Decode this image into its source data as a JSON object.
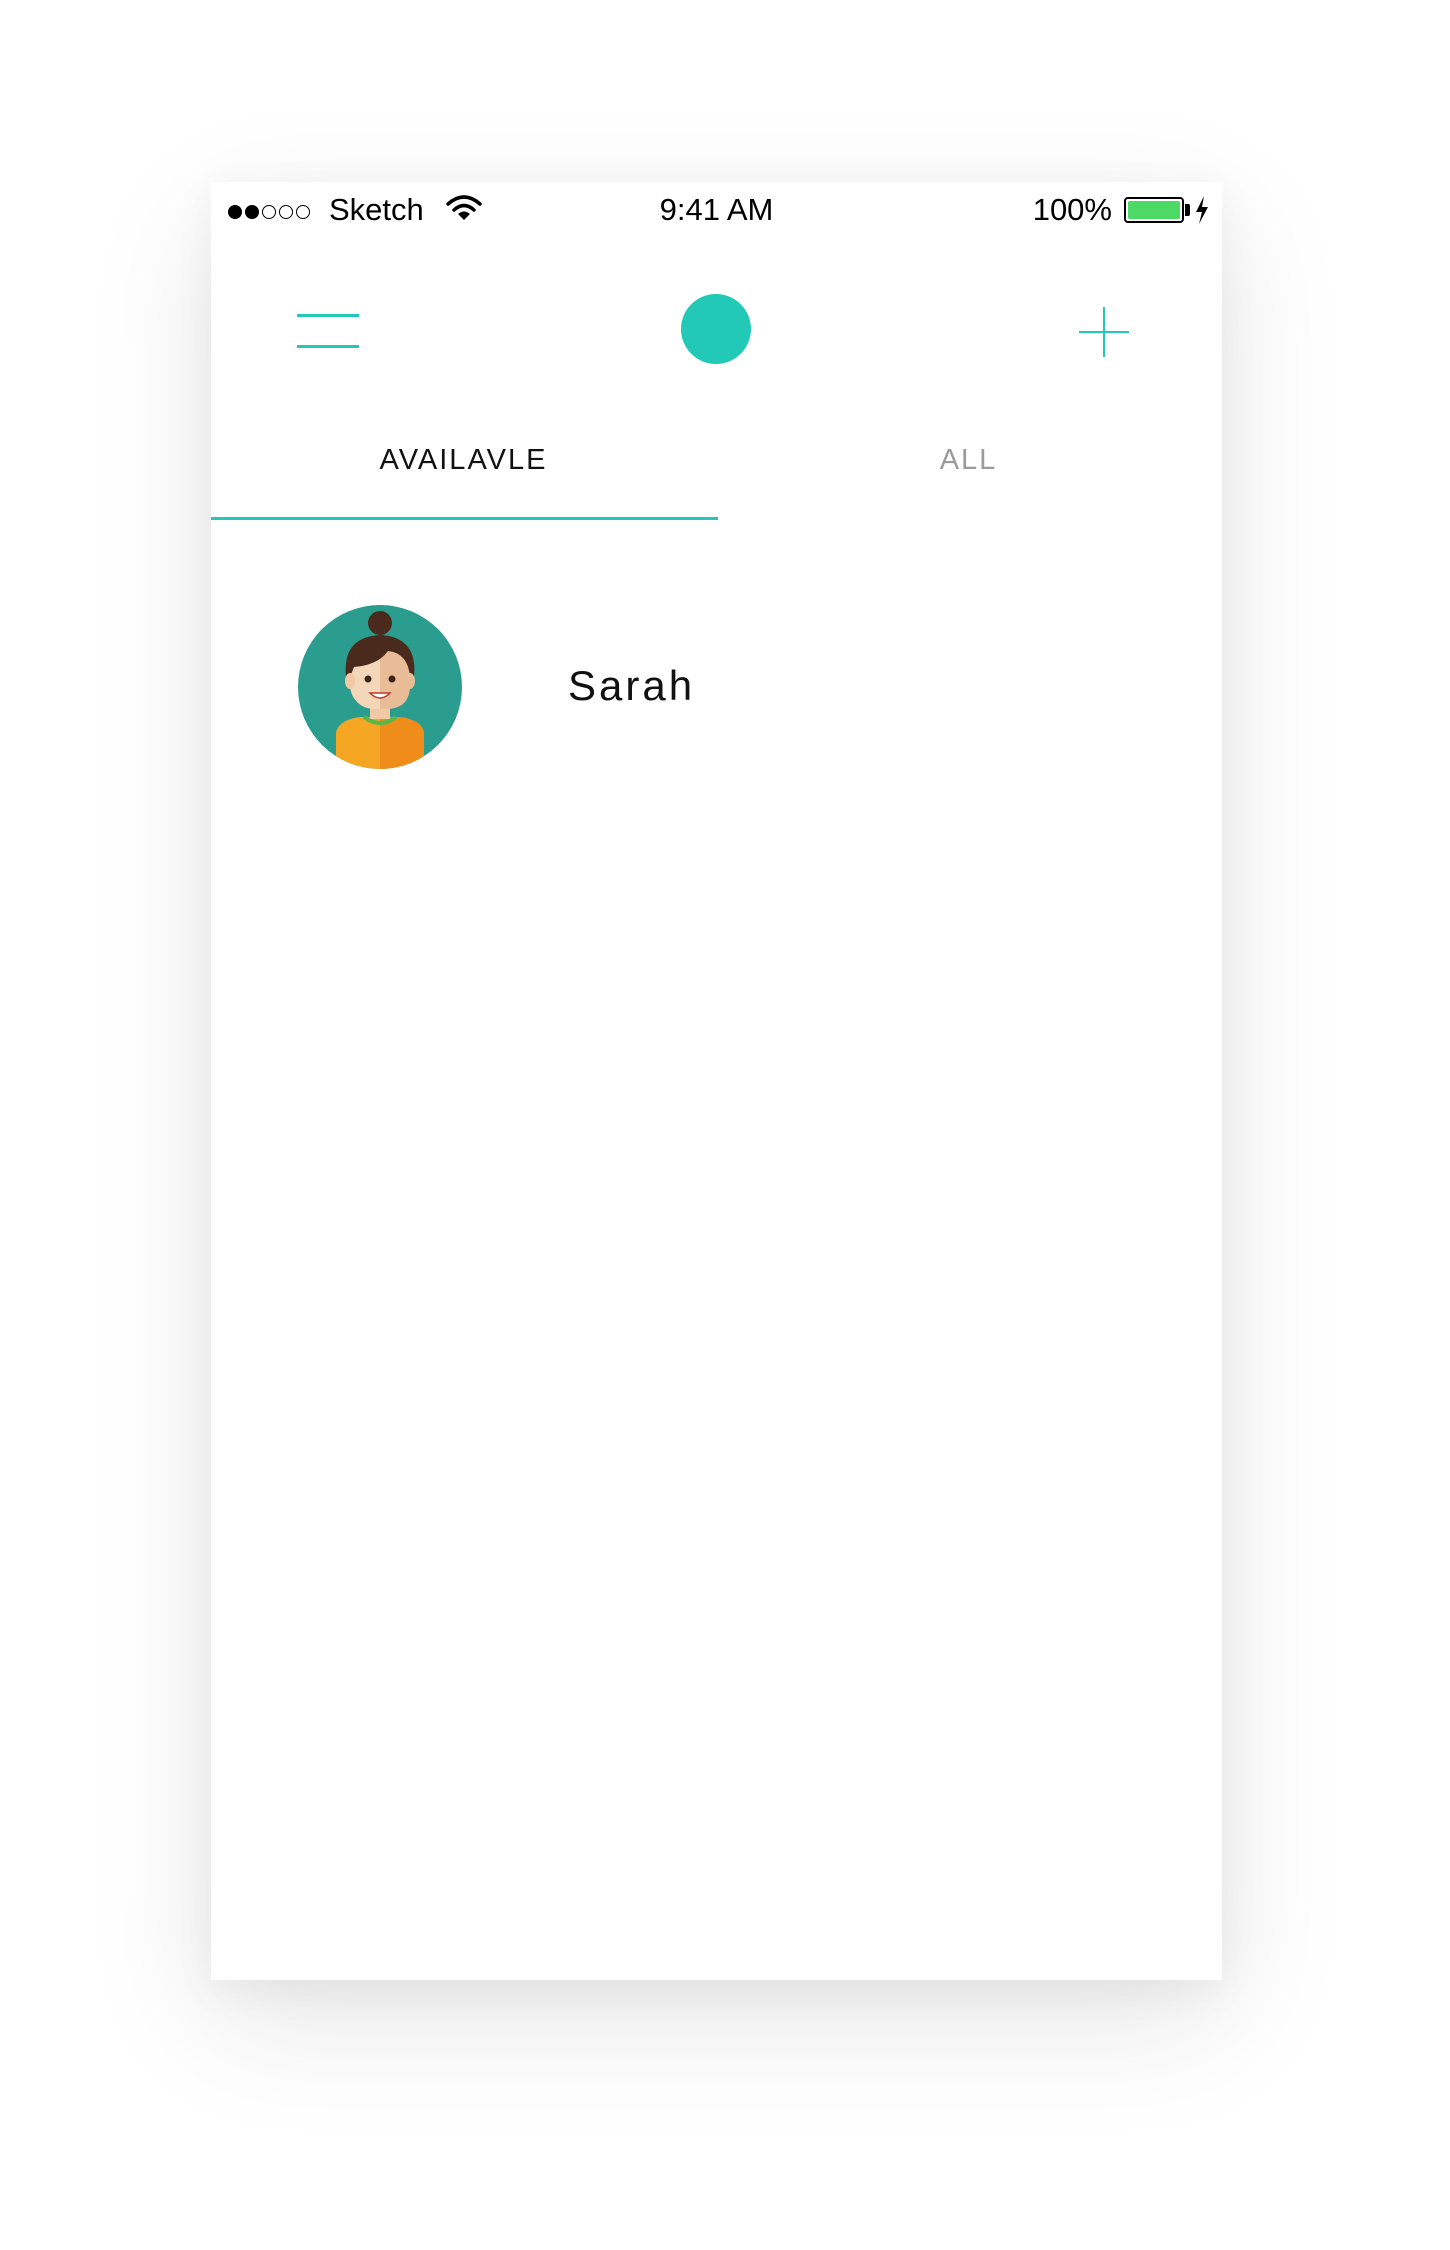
{
  "status_bar": {
    "carrier": "Sketch",
    "time": "9:41 AM",
    "battery_percent": "100%",
    "signal_strength_filled": 2,
    "signal_strength_total": 5,
    "battery_level": 1.0,
    "battery_color": "#4cd964"
  },
  "nav": {
    "menu_icon": "hamburger-menu-icon",
    "logo_icon": "logo-circle",
    "add_icon": "plus-icon",
    "accent_color": "#22c9b6"
  },
  "tabs": [
    {
      "label": "AVAILAVLE",
      "selected": true
    },
    {
      "label": "ALL",
      "selected": false
    }
  ],
  "contacts": [
    {
      "name": "Sarah",
      "avatar": "woman-avatar"
    }
  ]
}
